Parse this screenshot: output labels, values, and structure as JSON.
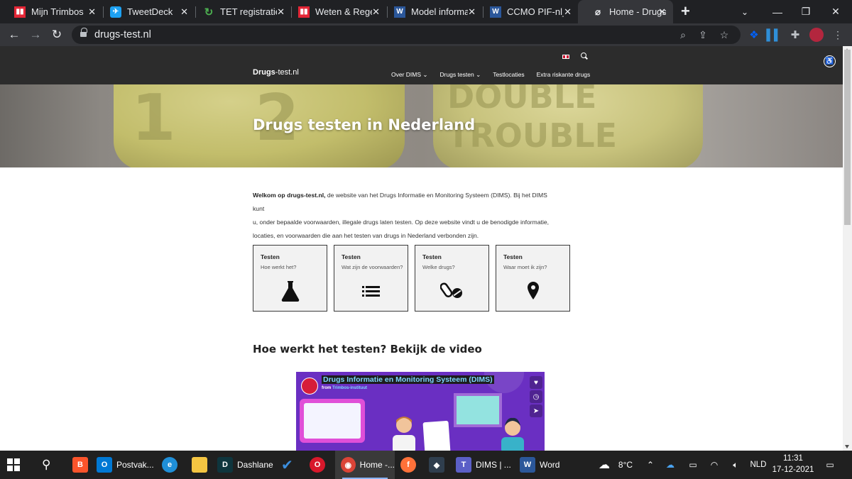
{
  "browser": {
    "tabs": [
      {
        "title": "Mijn Trimbos",
        "favicon": "trimbos-icon",
        "color": "#e32636",
        "glyph": "▮▮"
      },
      {
        "title": "TweetDeck",
        "favicon": "tweetdeck-icon",
        "color": "#1da1f2",
        "glyph": "✈"
      },
      {
        "title": "TET registratie",
        "favicon": "tet-icon",
        "color": "#4caf50",
        "glyph": "↻"
      },
      {
        "title": "Weten & Regelg",
        "favicon": "trimbos-icon",
        "color": "#e32636",
        "glyph": "▮▮"
      },
      {
        "title": "Model informa",
        "favicon": "word-icon",
        "color": "#2b579a",
        "glyph": "W"
      },
      {
        "title": "CCMO PIF-nl_a",
        "favicon": "word-icon",
        "color": "#2b579a",
        "glyph": "W"
      },
      {
        "title": "Home - Drugs",
        "favicon": "drugs-test-icon",
        "color": "#35363a",
        "glyph": "⌀"
      }
    ],
    "url": "drugs-test.nl"
  },
  "site": {
    "logo_bold": "Drugs",
    "logo_rest": "-test.nl",
    "nav": [
      {
        "label": "Over DIMS ⌄"
      },
      {
        "label": "Drugs testen ⌄"
      },
      {
        "label": "Testlocaties"
      },
      {
        "label": "Extra riskante drugs"
      }
    ],
    "hero_title": "Drugs testen in Nederland",
    "pill_left_text": "1 2",
    "pill_right_text": "DOUBLE TROUBLE",
    "intro_bold": "Welkom op drugs-test.nl,",
    "intro_line1": " de website van het Drugs Informatie en Monitoring Systeem (DIMS). Bij het DIMS kunt",
    "intro_line2": "u, onder bepaalde voorwaarden, illegale drugs laten testen. Op deze website vindt u de benodigde informatie,",
    "intro_line3": "locaties, en voorwaarden die aan het testen van drugs in Nederland verbonden zijn.",
    "cards": [
      {
        "title": "Testen",
        "subtitle": "Hoe werkt het?",
        "icon": "flask-icon"
      },
      {
        "title": "Testen",
        "subtitle": "Wat zijn de voorwaarden?",
        "icon": "list-icon"
      },
      {
        "title": "Testen",
        "subtitle": "Welke drugs?",
        "icon": "pills-icon"
      },
      {
        "title": "Testen",
        "subtitle": "Waar moet ik zijn?",
        "icon": "map-marker-icon"
      }
    ],
    "video_heading": "Hoe werkt het testen? Bekijk de video",
    "video": {
      "title": "Drugs Informatie en Monitoring Systeem (DIMS)",
      "from": "from",
      "channel": "Trimbos-instituut"
    }
  },
  "taskbar": {
    "items": [
      {
        "label": "Postvak...",
        "icon": "outlook-icon",
        "color": "#0078d4",
        "glyph": "O"
      },
      {
        "label": "Dashlane",
        "icon": "dashlane-icon",
        "color": "#0e353d",
        "glyph": "D"
      },
      {
        "label": "Home -...",
        "icon": "chrome-icon",
        "color": "#db4437",
        "glyph": "◉"
      },
      {
        "label": "DIMS | ...",
        "icon": "teams-icon",
        "color": "#5b5fc7",
        "glyph": "T"
      },
      {
        "label": "Word",
        "icon": "word-icon",
        "color": "#2b579a",
        "glyph": "W"
      }
    ],
    "weather": "8°C",
    "language": "NLD",
    "time": "11:31",
    "date": "17-12-2021"
  }
}
